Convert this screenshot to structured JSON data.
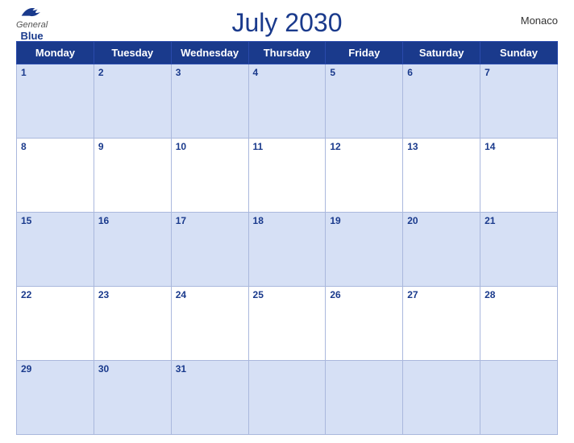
{
  "header": {
    "title": "July 2030",
    "region": "Monaco",
    "logo": {
      "general": "General",
      "blue": "Blue"
    }
  },
  "weekdays": [
    "Monday",
    "Tuesday",
    "Wednesday",
    "Thursday",
    "Friday",
    "Saturday",
    "Sunday"
  ],
  "weeks": [
    [
      {
        "day": 1
      },
      {
        "day": 2
      },
      {
        "day": 3
      },
      {
        "day": 4
      },
      {
        "day": 5
      },
      {
        "day": 6
      },
      {
        "day": 7
      }
    ],
    [
      {
        "day": 8
      },
      {
        "day": 9
      },
      {
        "day": 10
      },
      {
        "day": 11
      },
      {
        "day": 12
      },
      {
        "day": 13
      },
      {
        "day": 14
      }
    ],
    [
      {
        "day": 15
      },
      {
        "day": 16
      },
      {
        "day": 17
      },
      {
        "day": 18
      },
      {
        "day": 19
      },
      {
        "day": 20
      },
      {
        "day": 21
      }
    ],
    [
      {
        "day": 22
      },
      {
        "day": 23
      },
      {
        "day": 24
      },
      {
        "day": 25
      },
      {
        "day": 26
      },
      {
        "day": 27
      },
      {
        "day": 28
      }
    ],
    [
      {
        "day": 29
      },
      {
        "day": 30
      },
      {
        "day": 31
      },
      {
        "day": null
      },
      {
        "day": null
      },
      {
        "day": null
      },
      {
        "day": null
      }
    ]
  ]
}
